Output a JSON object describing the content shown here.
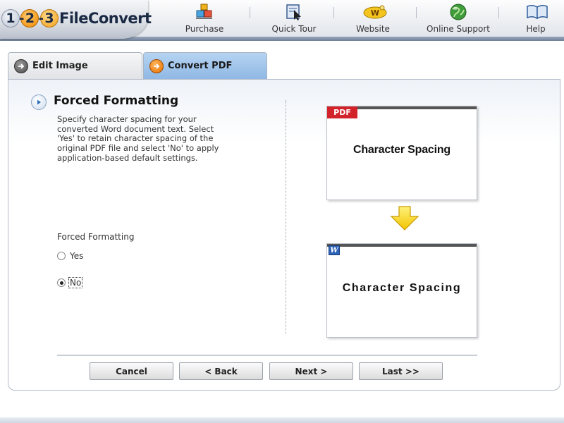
{
  "logo": {
    "num1": "1",
    "num2": "2",
    "num3": "3",
    "dash1": "-",
    "dash2": "-",
    "brand": "FileConvert"
  },
  "nav": {
    "items": [
      {
        "label": "Purchase",
        "icon": "cart-boxes-icon"
      },
      {
        "label": "Quick Tour",
        "icon": "pointer-tour-icon"
      },
      {
        "label": "Website",
        "icon": "www-icon"
      },
      {
        "label": "Online Support",
        "icon": "globe-icon"
      },
      {
        "label": "Help",
        "icon": "book-icon"
      }
    ]
  },
  "tabs": [
    {
      "label": "Edit Image",
      "icon": "arrow-circle-icon",
      "active": false
    },
    {
      "label": "Convert PDF",
      "icon": "arrow-circle-icon",
      "active": true
    }
  ],
  "main": {
    "title": "Forced Formatting",
    "description": "Specify character spacing for your converted Word document text. Select 'Yes'  to retain character spacing of the original PDF file and select 'No' to apply application-based default settings.",
    "field_label": "Forced Formatting",
    "options": [
      {
        "label": "Yes",
        "selected": false
      },
      {
        "label": "No",
        "selected": true
      }
    ]
  },
  "preview": {
    "pdf_badge": "PDF",
    "pdf_text": "Character Spacing",
    "word_badge": "W",
    "word_text": "Character Spacing"
  },
  "buttons": {
    "cancel": "Cancel",
    "back": "< Back",
    "next": "Next >",
    "last": "Last >>"
  },
  "colors": {
    "accent_tab": "#9fc3ea",
    "pdf_red": "#d3232a",
    "word_blue": "#2d63b8",
    "arrow_yellow": "#f7d21c"
  }
}
